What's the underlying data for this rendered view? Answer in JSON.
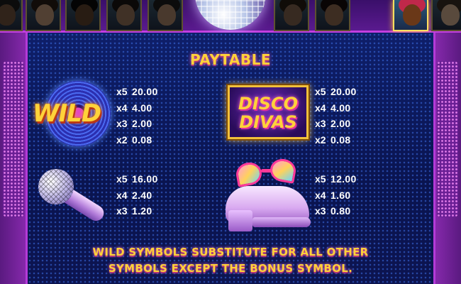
{
  "header": {
    "portraits": [
      {
        "name": "character-portrait-1",
        "face": "#7a4a2a",
        "hair": "#1a1a1a",
        "state": "dim"
      },
      {
        "name": "character-portrait-2",
        "face": "#c88a5a",
        "hair": "#2a1a10",
        "state": "dim"
      },
      {
        "name": "character-portrait-3",
        "face": "#6a3a1a",
        "hair": "#0a0a0a",
        "state": "dim"
      },
      {
        "name": "character-portrait-4",
        "face": "#a06a40",
        "hair": "#1a1410",
        "state": "dim"
      },
      {
        "name": "character-portrait-5",
        "face": "#b87a50",
        "hair": "#1a1a1a",
        "state": "dim"
      },
      {
        "name": "character-portrait-6",
        "face": "#8a5a3a",
        "hair": "#2a1a0a",
        "state": "dim"
      },
      {
        "name": "character-portrait-7",
        "face": "#9a6038",
        "hair": "#1a0a0a",
        "state": "dim"
      },
      {
        "name": "character-portrait-8",
        "face": "#6a3818",
        "hair": "#c0284a",
        "state": "active"
      },
      {
        "name": "character-portrait-9",
        "face": "#d8a070",
        "hair": "#3a2a1a",
        "state": "dim"
      }
    ]
  },
  "paytable": {
    "title": "PAYTABLE",
    "symbols": [
      {
        "id": "wild",
        "label": "WILD",
        "pays": [
          {
            "mult": "x5",
            "amount": "20.00"
          },
          {
            "mult": "x4",
            "amount": "4.00"
          },
          {
            "mult": "x3",
            "amount": "2.00"
          },
          {
            "mult": "x2",
            "amount": "0.08"
          }
        ]
      },
      {
        "id": "disco-divas",
        "label_line1": "DISCO",
        "label_line2": "DIVAS",
        "pays": [
          {
            "mult": "x5",
            "amount": "20.00"
          },
          {
            "mult": "x4",
            "amount": "4.00"
          },
          {
            "mult": "x3",
            "amount": "2.00"
          },
          {
            "mult": "x2",
            "amount": "0.08"
          }
        ]
      },
      {
        "id": "microphone",
        "pays": [
          {
            "mult": "x5",
            "amount": "16.00"
          },
          {
            "mult": "x4",
            "amount": "2.40"
          },
          {
            "mult": "x3",
            "amount": "1.20"
          }
        ]
      },
      {
        "id": "shoe-and-glasses",
        "pays": [
          {
            "mult": "x5",
            "amount": "12.00"
          },
          {
            "mult": "x4",
            "amount": "1.60"
          },
          {
            "mult": "x3",
            "amount": "0.80"
          }
        ]
      }
    ],
    "note_line1": "WILD SYMBOLS SUBSTITUTE FOR ALL OTHER",
    "note_line2": "SYMBOLS EXCEPT THE BONUS SYMBOL."
  },
  "colors": {
    "accent_gold": "#ffd23a",
    "frame_purple": "#b43ad8",
    "panel_blue": "#0e1f6a"
  }
}
